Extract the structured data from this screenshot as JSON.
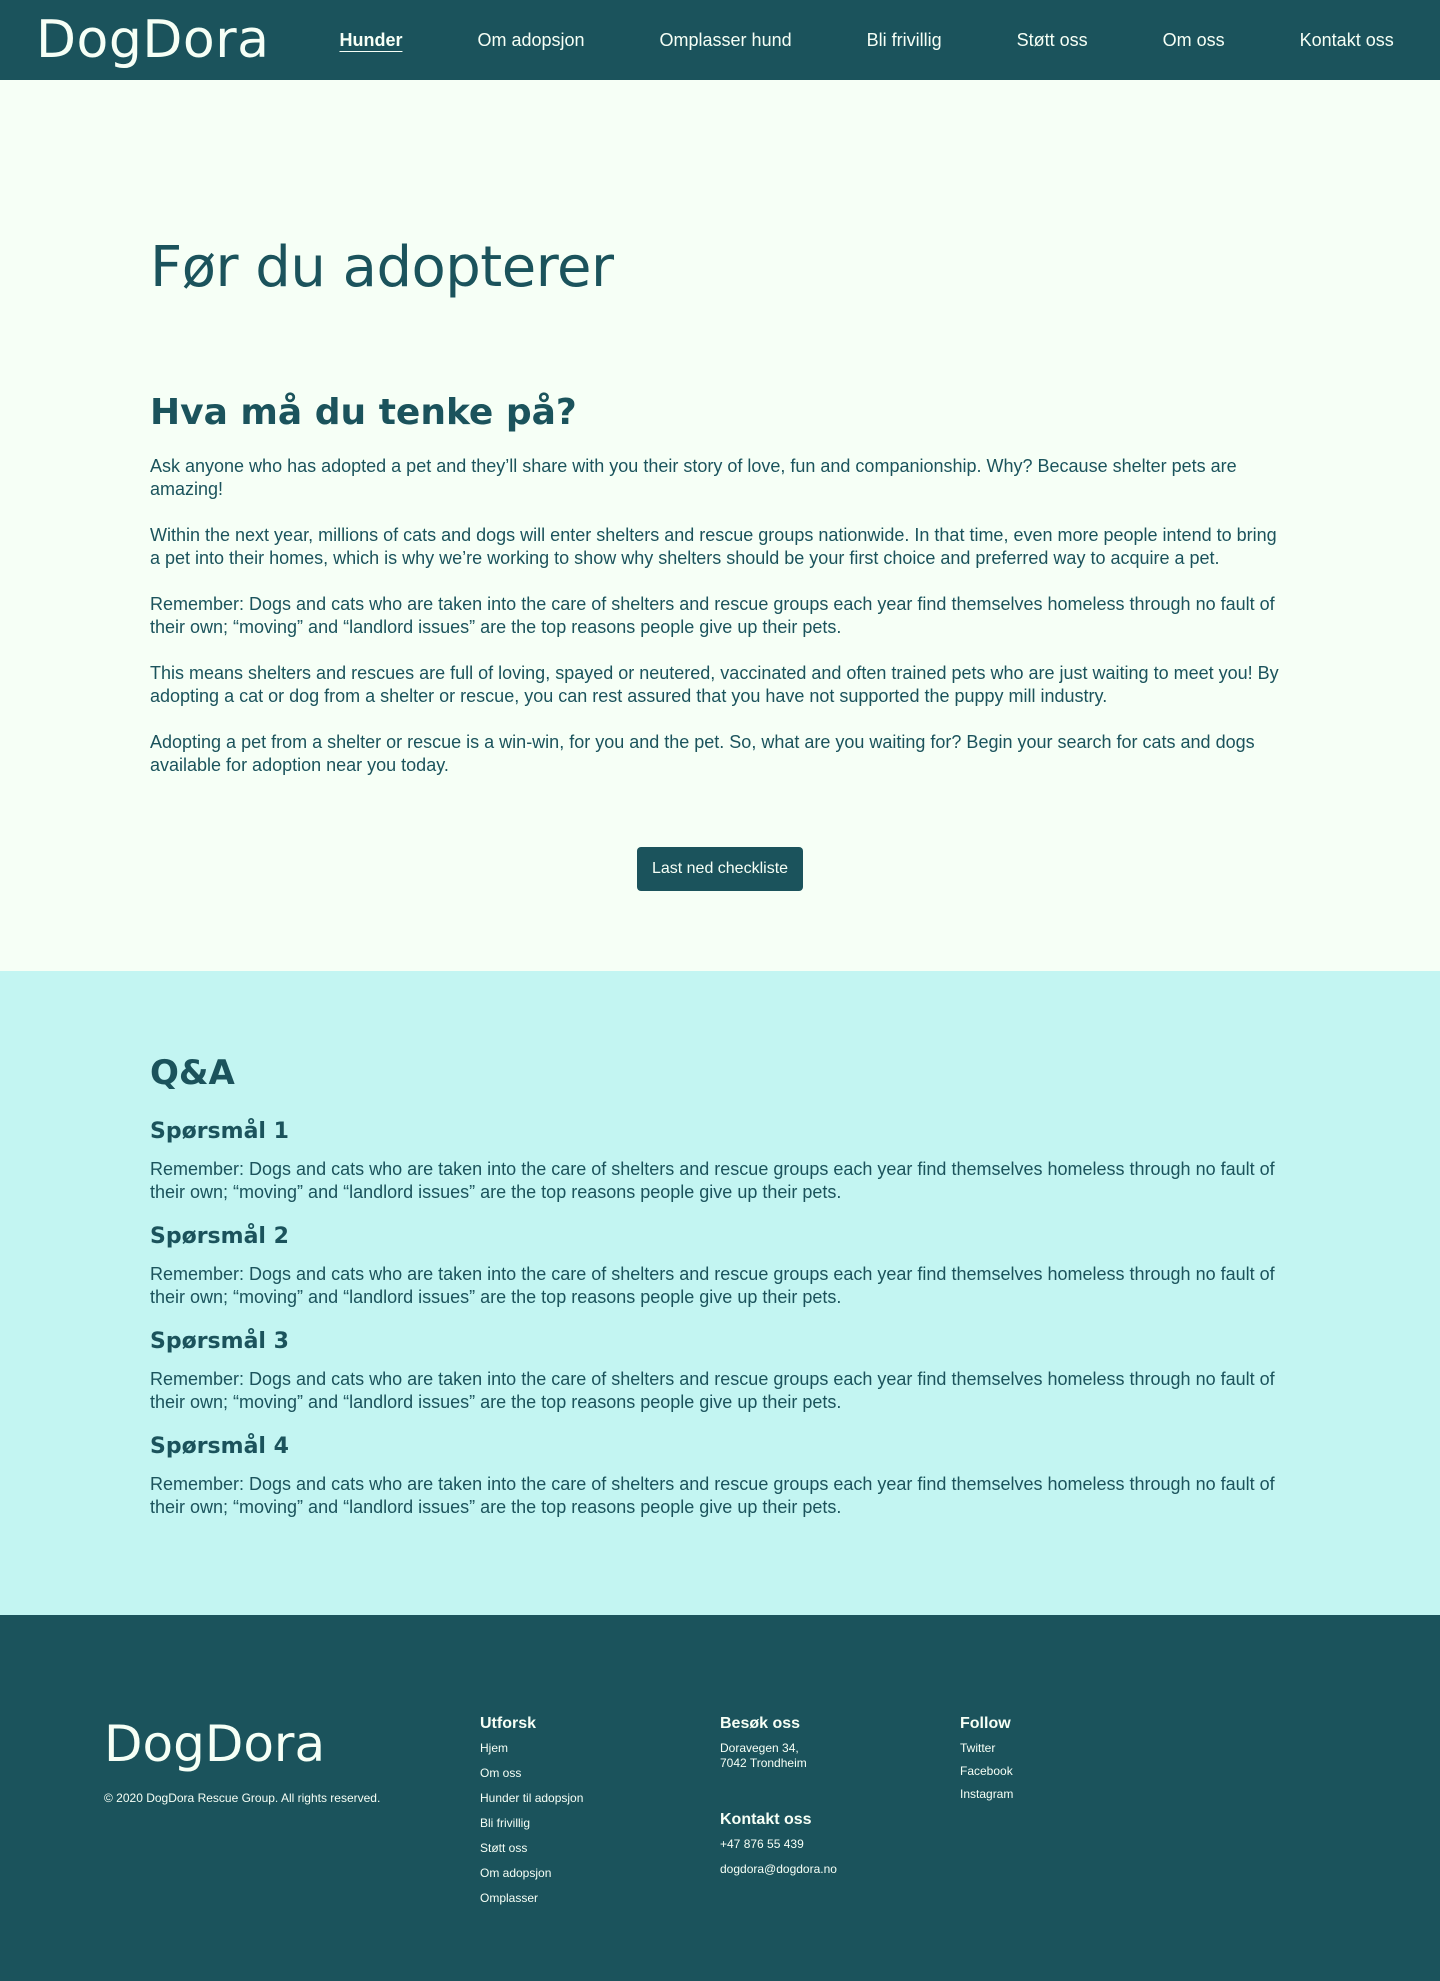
{
  "header": {
    "logo": "DogDora",
    "nav": [
      {
        "label": "Hunder",
        "active": true
      },
      {
        "label": "Om adopsjon"
      },
      {
        "label": "Omplasser hund"
      },
      {
        "label": "Bli frivillig"
      },
      {
        "label": "Støtt oss"
      },
      {
        "label": "Om oss"
      },
      {
        "label": "Kontakt oss"
      }
    ]
  },
  "main": {
    "title": "Før du adopterer",
    "section_title": "Hva må du tenke på?",
    "paragraphs": [
      "Ask anyone who has adopted a pet and they’ll share with you their story of love, fun and companionship. Why? Because shelter pets are amazing!",
      "Within the next year, millions of cats and dogs will enter shelters and rescue groups nationwide. In that time, even more people intend to bring a pet into their homes, which is why we’re working to show why shelters should be your first choice and preferred way to acquire a pet.",
      "Remember: Dogs and cats who are taken into the care of shelters and rescue groups each year find themselves homeless through no fault of their own; “moving” and “landlord issues” are the top reasons people give up their pets.",
      "This means shelters and rescues are full of loving, spayed or neutered, vaccinated and often trained pets who are just waiting to meet you! By adopting a cat or dog from a shelter or rescue, you can rest assured that you have not supported the puppy mill industry.",
      "Adopting a pet from a shelter or rescue is a win-win, for you and the pet. So, what are you waiting for? Begin your search for cats and dogs available for adoption near you today."
    ],
    "button_label": "Last ned checkliste"
  },
  "qa": {
    "title": "Q&A",
    "items": [
      {
        "question": "Spørsmål 1",
        "answer": "Remember: Dogs and cats who are taken into the care of shelters and rescue groups each year find themselves homeless through no fault of their own; “moving” and “landlord issues” are the top reasons people give up their pets."
      },
      {
        "question": "Spørsmål 2",
        "answer": "Remember: Dogs and cats who are taken into the care of shelters and rescue groups each year find themselves homeless through no fault of their own; “moving” and “landlord issues” are the top reasons people give up their pets."
      },
      {
        "question": "Spørsmål 3",
        "answer": "Remember: Dogs and cats who are taken into the care of shelters and rescue groups each year find themselves homeless through no fault of their own; “moving” and “landlord issues” are the top reasons people give up their pets."
      },
      {
        "question": "Spørsmål 4",
        "answer": "Remember: Dogs and cats who are taken into the care of shelters and rescue groups each year find themselves homeless through no fault of their own; “moving” and “landlord issues” are the top reasons people give up their pets."
      }
    ]
  },
  "footer": {
    "logo": "DogDora",
    "copyright": "© 2020 DogDora Rescue Group. All rights reserved.",
    "explore": {
      "title": "Utforsk",
      "links": [
        "Hjem",
        "Om oss",
        "Hunder til adopsjon",
        "Bli frivillig",
        "Støtt oss",
        "Om adopsjon",
        "Omplasser"
      ]
    },
    "visit": {
      "title": "Besøk oss",
      "address_line1": "Doravegen 34,",
      "address_line2": "7042 Trondheim"
    },
    "contact": {
      "title": "Kontakt oss",
      "phone": " +47 876 55 439",
      "email": "dogdora@dogdora.no"
    },
    "follow": {
      "title": "Follow",
      "links": [
        "Twitter",
        "Facebook",
        "Instagram"
      ]
    }
  },
  "colors": {
    "primary": "#1b535c",
    "background": "#f6fff6",
    "qa_background": "#c3f5f2"
  }
}
